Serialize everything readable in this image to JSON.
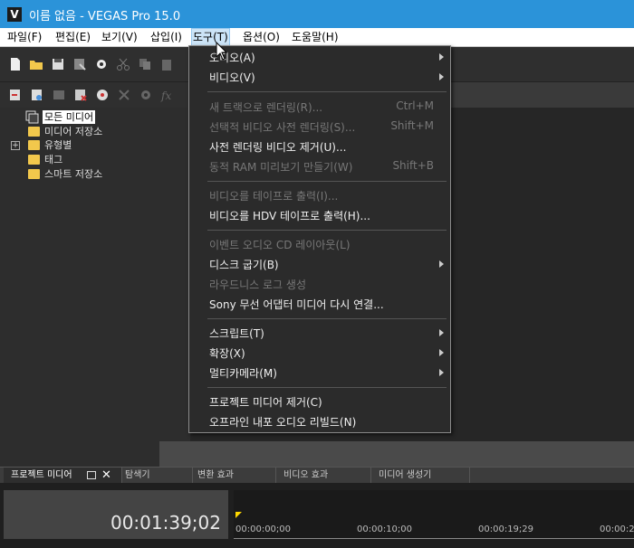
{
  "window": {
    "title": "이름 없음 - VEGAS Pro 15.0",
    "app_icon_letter": "V"
  },
  "menubar": [
    {
      "label": "파일(F)"
    },
    {
      "label": "편집(E)"
    },
    {
      "label": "보기(V)"
    },
    {
      "label": "삽입(I)"
    },
    {
      "label": "도구(T)"
    },
    {
      "label": "옵션(O)"
    },
    {
      "label": "도움말(H)"
    }
  ],
  "tools_menu": {
    "items": [
      {
        "label": "오디오(A)",
        "submenu": true,
        "disabled": false
      },
      {
        "label": "비디오(V)",
        "submenu": true,
        "disabled": false
      },
      {
        "label": "새 트랙으로 렌더링(R)...",
        "shortcut": "Ctrl+M",
        "disabled": true
      },
      {
        "label": "선택적 비디오 사전 렌더링(S)...",
        "shortcut": "Shift+M",
        "disabled": true
      },
      {
        "label": "사전 렌더링 비디오 제거(U)...",
        "disabled": false
      },
      {
        "label": "동적 RAM 미리보기 만들기(W)",
        "shortcut": "Shift+B",
        "disabled": true
      },
      {
        "label": "비디오를 테이프로 출력(I)...",
        "disabled": true
      },
      {
        "label": "비디오를 HDV 테이프로 출력(H)...",
        "disabled": false
      },
      {
        "label": "이벤트 오디오 CD 레이아웃(L)",
        "disabled": true
      },
      {
        "label": "디스크 굽기(B)",
        "submenu": true,
        "disabled": false
      },
      {
        "label": "라우드니스 로그 생성",
        "disabled": true
      },
      {
        "label": "Sony 무선 어댑터 미디어 다시 연결...",
        "disabled": false
      },
      {
        "label": "스크립트(T)",
        "submenu": true,
        "disabled": false
      },
      {
        "label": "확장(X)",
        "submenu": true,
        "disabled": false
      },
      {
        "label": "멀티카메라(M)",
        "submenu": true,
        "disabled": false
      },
      {
        "label": "프로젝트 미디어 제거(C)",
        "disabled": false
      },
      {
        "label": "오프라인 내포 오디오 리빌드(N)",
        "disabled": false
      }
    ]
  },
  "media_tree": [
    {
      "label": "모든 미디어",
      "selected": true
    },
    {
      "label": "미디어 저장소"
    },
    {
      "label": "유형별",
      "expandable": true
    },
    {
      "label": "태그"
    },
    {
      "label": "스마트 저장소"
    }
  ],
  "tabs": [
    {
      "label": "프로젝트 미디어"
    },
    {
      "label": "탐색기"
    },
    {
      "label": "변환 효과"
    },
    {
      "label": "비디오 효과"
    },
    {
      "label": "미디어 생성기"
    }
  ],
  "timeline": {
    "timecode": "00:01:39;02",
    "ruler": [
      "00:00:00;00",
      "00:00:10;00",
      "00:00:19;29",
      "00:00:2"
    ]
  },
  "colors": {
    "titlebar": "#2b93d9",
    "accent_folder": "#f2c84c",
    "playhead": "#ffd800"
  }
}
